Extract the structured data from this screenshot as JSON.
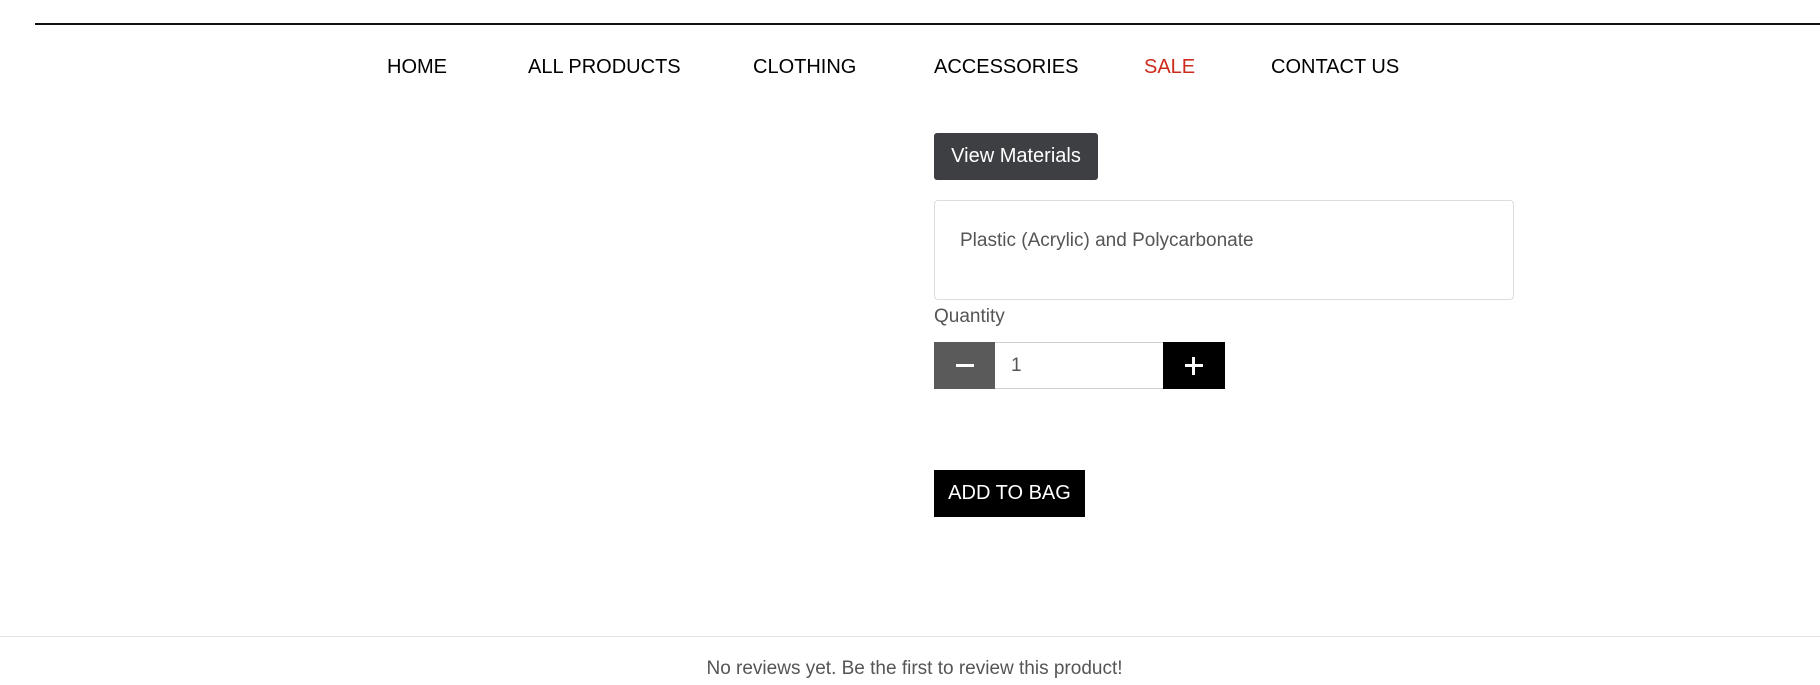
{
  "nav": {
    "items": [
      {
        "label": "HOME"
      },
      {
        "label": "ALL PRODUCTS"
      },
      {
        "label": "CLOTHING"
      },
      {
        "label": "ACCESSORIES"
      },
      {
        "label": "SALE"
      },
      {
        "label": "CONTACT US"
      }
    ],
    "sale_color": "#cc2a1c"
  },
  "product": {
    "materials_button_label": "View Materials",
    "materials_text": "Plastic (Acrylic) and Polycarbonate",
    "quantity_label": "Quantity",
    "quantity_value": "1",
    "decrement_icon": "minus-icon",
    "increment_icon": "plus-icon",
    "add_to_bag_label": "ADD TO BAG"
  },
  "reviews": {
    "empty_message": "No reviews yet. Be the first to review this product!"
  }
}
